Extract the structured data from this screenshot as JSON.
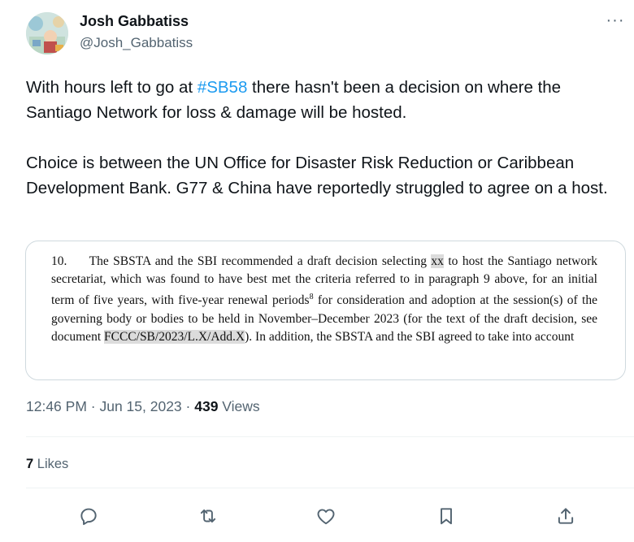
{
  "author": {
    "display_name": "Josh Gabbatiss",
    "handle": "@Josh_Gabbatiss",
    "more_icon": "more-horizontal-icon"
  },
  "tweet": {
    "p1_before": "With hours left to go at ",
    "p1_hashtag": "#SB58",
    "p1_after": " there hasn't been a decision on where the Santiago Network for loss & damage will be hosted.",
    "p2": "Choice is between the UN Office for Disaster Risk Reduction or Caribbean Development Bank. G77 & China have reportedly struggled to agree on a host."
  },
  "document_excerpt": {
    "t1": "10.     The SBSTA and the SBI recommended a draft decision selecting ",
    "hl1": "xx",
    "t2": " to host the Santiago network secretariat, which was found to have best met the criteria referred to in paragraph 9 above, for an initial term of five years, with five-year renewal periods",
    "footnote": "8",
    "t3": " for consideration and adoption at the session(s) of the governing body or bodies to be held in November–December 2023 (for the text of the draft decision, see document ",
    "hl2": "FCCC/SB/2023/L.X/Add.X",
    "t4": "). In addition, the SBSTA and the SBI agreed to take into account"
  },
  "meta": {
    "time": "12:46 PM",
    "sep1": " · ",
    "date": "Jun 15, 2023",
    "sep2": " · ",
    "views_count": "439",
    "views_label": " Views"
  },
  "engagement": {
    "likes_count": "7",
    "likes_label": " Likes"
  },
  "actions": [
    "reply-icon",
    "retweet-icon",
    "like-icon",
    "bookmark-icon",
    "share-icon"
  ],
  "colors": {
    "accent": "#1d9bf0",
    "text": "#0f1419",
    "secondary": "#536471",
    "border": "#cfd9de"
  }
}
